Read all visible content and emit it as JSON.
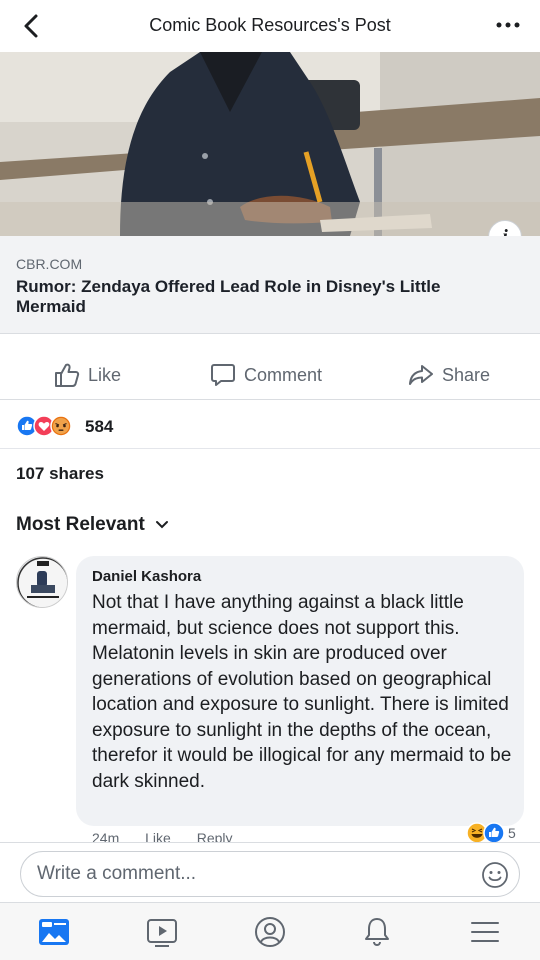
{
  "header": {
    "title": "Comic Book Resources's Post",
    "back_icon": "chevron-left-icon",
    "more_icon": "more-dots-icon"
  },
  "link_card": {
    "domain": "CBR.COM",
    "title": "Rumor: Zendaya Offered Lead Role in Disney's Little Mermaid",
    "info_icon": "i"
  },
  "actions": {
    "like": "Like",
    "comment": "Comment",
    "share": "Share"
  },
  "reactions": {
    "types": [
      "like",
      "love",
      "angry"
    ],
    "count": "584"
  },
  "shares": "107 shares",
  "comments_filter": "Most Relevant",
  "comment": {
    "author": "Daniel Kashora",
    "text": "Not that I have anything against a black little mermaid, but science does not support this. Melatonin levels in skin are produced over generations of evolution based on geographical location and exposure to sunlight. There is limited exposure to sunlight in the depths of the ocean, therefor it would be illogical for any mermaid to be dark skinned.",
    "time": "24m",
    "like": "Like",
    "reply": "Reply",
    "reaction_count": "5",
    "reaction_types": [
      "haha",
      "like"
    ]
  },
  "composer": {
    "placeholder": "Write a comment..."
  },
  "tabs": [
    "news-feed-icon",
    "watch-icon",
    "profile-icon",
    "notifications-icon",
    "menu-icon"
  ],
  "colors": {
    "brand_blue": "#1877f2",
    "love_red": "#f33e58",
    "angry_orange": "#e9710f",
    "haha_yellow": "#f7b125",
    "text_secondary": "#606770"
  }
}
